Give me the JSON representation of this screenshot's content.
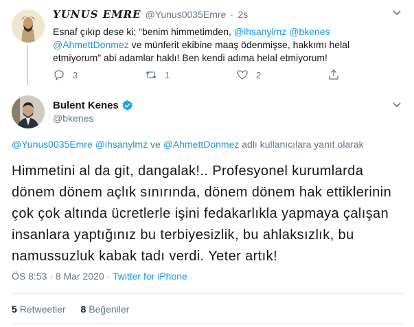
{
  "parent_tweet": {
    "display_name": "YUNUS EMRE",
    "handle": "@Yunus0035Emre",
    "separator": "·",
    "time": "2s",
    "text_1": "Esnaf çıkıp dese ki; “benim himmetimden, ",
    "mention_1": "@ihsanylmz",
    "text_2": " ",
    "mention_2": "@bkenes",
    "text_3": " ",
    "mention_3": "@AhmettDonmez",
    "text_4": " ve münferit ekibine maaş ödenmişse, hakkımı helal etmiyorum” abi adamlar haklı! Ben kendi adıma helal etmiyorum!",
    "reply_count": "3",
    "retweet_count": "1",
    "like_count": "2",
    "icons": [
      "reply-icon",
      "retweet-icon",
      "like-icon",
      "share-icon",
      "chevron-down-icon"
    ]
  },
  "main_tweet": {
    "display_name": "Bulent Kenes",
    "handle": "@bkenes",
    "replying_mention_1": "@Yunus0035Emre",
    "replying_sep_1": " ",
    "replying_mention_2": "@ihsanylmz",
    "replying_and": " ve ",
    "replying_mention_3": "@AhmettDonmez",
    "replying_suffix": " adlı kullanıcılara yanıt olarak",
    "text": "Himmetini al da git, dangalak!.. Profesyonel kurumlarda dönem dönem açlık sınırında, dönem dönem hak ettiklerinin çok çok altında ücretlerle işini fedakarlıkla yapmaya çalışan insanlara yaptığınız bu terbiyesizlik, bu ahlaksızlık, bu namussuzluk kabak tadı verdi. Yeter artık!",
    "time": "ÖS 8:53",
    "date": "8 Mar 2020",
    "meta_sep": " · ",
    "source": "Twitter for iPhone",
    "retweet_count": "5",
    "retweet_label": "Retweetler",
    "like_count": "8",
    "like_label": "Beğeniler",
    "verified_color": "#1da1f2",
    "link_color": "#1b95e0"
  }
}
